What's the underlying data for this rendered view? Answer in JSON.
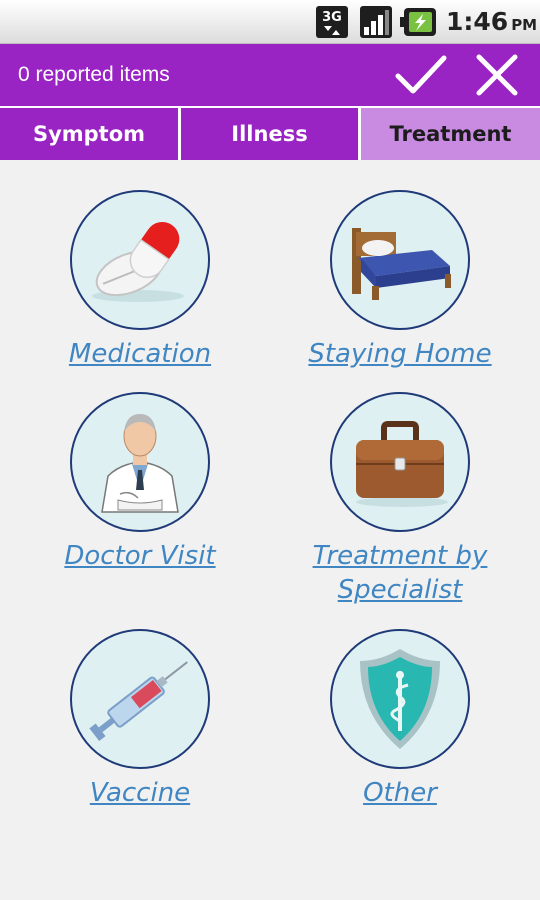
{
  "status_bar": {
    "network_label": "3G",
    "time": "1:46",
    "ampm": "PM",
    "icons": [
      "3g-network-icon",
      "signal-strength-icon",
      "battery-charging-icon"
    ]
  },
  "action_bar": {
    "title": "0 reported items",
    "confirm_icon": "check-icon",
    "close_icon": "close-icon",
    "color": "#9a23c4"
  },
  "tabs": [
    {
      "label": "Symptom",
      "selected": false
    },
    {
      "label": "Illness",
      "selected": false
    },
    {
      "label": "Treatment",
      "selected": true
    }
  ],
  "colors": {
    "accent": "#9a23c4",
    "tab_selected": "#c98ae2",
    "link": "#3f86c2",
    "circle_border": "#1f3a78",
    "circle_fill": "#dff0f2"
  },
  "items": [
    {
      "label": "Medication",
      "icon": "pills-icon"
    },
    {
      "label": "Staying Home",
      "icon": "bed-icon"
    },
    {
      "label": "Doctor Visit",
      "icon": "doctor-icon"
    },
    {
      "label_line1": "Treatment by",
      "label_line2": "Specialist",
      "icon": "briefcase-icon"
    },
    {
      "label": "Vaccine",
      "icon": "syringe-icon"
    },
    {
      "label": "Other",
      "icon": "medical-shield-icon"
    }
  ]
}
